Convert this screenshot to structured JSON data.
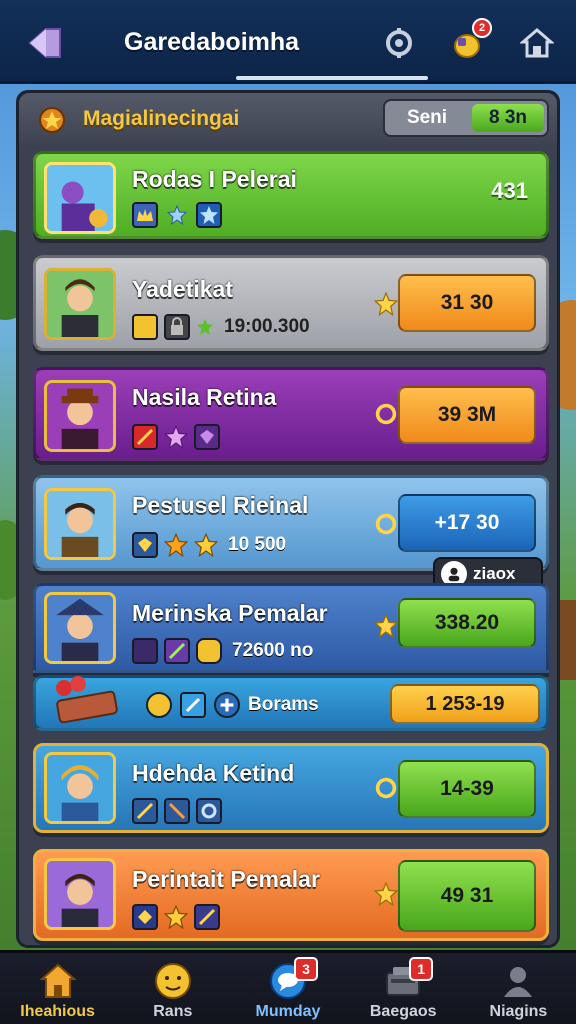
{
  "header": {
    "title": "Garedaboimha",
    "gift_badge": "2"
  },
  "panel": {
    "title": "Magialinecingai",
    "toggle_left": "Seni",
    "toggle_right": "8 3n"
  },
  "cards": [
    {
      "name": "Rodas I Pelerai",
      "value": "431"
    },
    {
      "name": "Yadetikat",
      "stat": "19:00.300",
      "value": "31 30"
    },
    {
      "name": "Nasila Retina",
      "value": "39 3M"
    },
    {
      "name": "Pestusel Rieinal",
      "stat": "10 500",
      "value": "+17 30"
    },
    {
      "name": "Merinska Pemalar",
      "stat": "72600 no",
      "value": "338.20"
    },
    {
      "name": "Hdehda Ketind",
      "value": "14-39"
    },
    {
      "name": "Perintait Pemalar",
      "value": "49 31"
    }
  ],
  "tooltip": {
    "label": "ziaox"
  },
  "promo": {
    "label": "Borams",
    "value": "1 253-19"
  },
  "nav": [
    {
      "label": "Iheahious"
    },
    {
      "label": "Rans"
    },
    {
      "label": "Mumday",
      "badge": "3"
    },
    {
      "label": "Baegaos",
      "badge": "1"
    },
    {
      "label": "Niagins"
    }
  ],
  "colors": {
    "topbar": "#123059",
    "panel": "#3b4150",
    "accent_gold": "#f3c842",
    "notification": "#e02b2b"
  }
}
